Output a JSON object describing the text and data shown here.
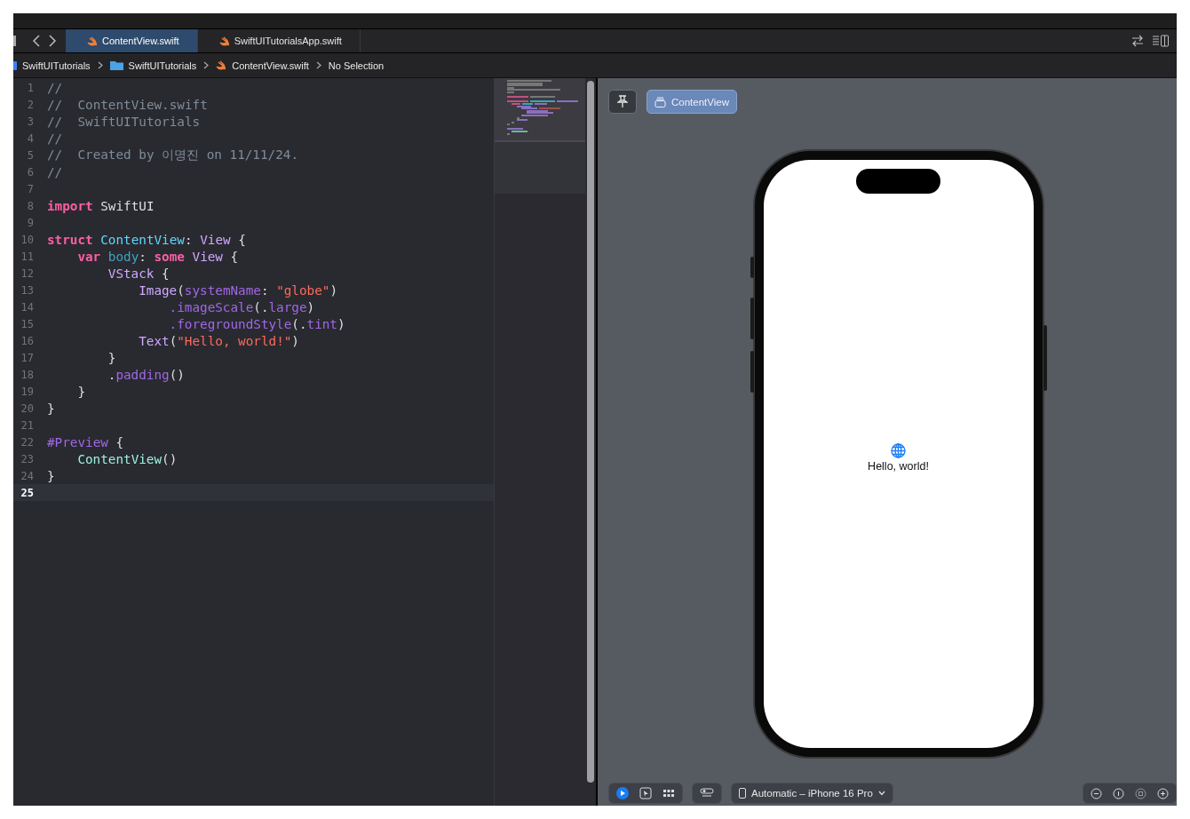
{
  "tab_bar": {
    "tabs": [
      {
        "label": "ContentView.swift",
        "selected": true
      },
      {
        "label": "SwiftUITutorialsApp.swift",
        "selected": false
      }
    ]
  },
  "breadcrumb": [
    {
      "label": "SwiftUITutorials",
      "kind": "project"
    },
    {
      "label": "SwiftUITutorials",
      "kind": "folder"
    },
    {
      "label": "ContentView.swift",
      "kind": "file"
    },
    {
      "label": "No Selection",
      "kind": "text"
    }
  ],
  "editor": {
    "lines": [
      {
        "number": "1",
        "current": false,
        "tokens": [
          {
            "text": "//",
            "kind": "comment"
          }
        ]
      },
      {
        "number": "2",
        "current": false,
        "tokens": [
          {
            "text": "//  ContentView.swift",
            "kind": "comment"
          }
        ]
      },
      {
        "number": "3",
        "current": false,
        "tokens": [
          {
            "text": "//  SwiftUITutorials",
            "kind": "comment"
          }
        ]
      },
      {
        "number": "4",
        "current": false,
        "tokens": [
          {
            "text": "//",
            "kind": "comment"
          }
        ]
      },
      {
        "number": "5",
        "current": false,
        "tokens": [
          {
            "text": "//  Created by 이명진 on 11/11/24.",
            "kind": "comment"
          }
        ]
      },
      {
        "number": "6",
        "current": false,
        "tokens": [
          {
            "text": "//",
            "kind": "comment"
          }
        ]
      },
      {
        "number": "7",
        "current": false
      },
      {
        "number": "8",
        "current": false,
        "tokens": [
          {
            "text": "import",
            "kind": "keyword"
          },
          {
            "text": " SwiftUI",
            "kind": "plain"
          }
        ]
      },
      {
        "number": "9",
        "current": false
      },
      {
        "number": "10",
        "current": false,
        "tokens": [
          {
            "text": "struct",
            "kind": "keyword"
          },
          {
            "text": " ContentView",
            "kind": "decl"
          },
          {
            "text": ": ",
            "kind": "plain"
          },
          {
            "text": "View",
            "kind": "type"
          },
          {
            "text": " {",
            "kind": "plain"
          }
        ],
        "children": [
          {
            "number": "11",
            "current": false,
            "tokens": [
              {
                "text": "var",
                "kind": "keyword"
              },
              {
                "text": " body",
                "kind": "property"
              },
              {
                "text": ": ",
                "kind": "plain"
              },
              {
                "text": "some",
                "kind": "keyword"
              },
              {
                "text": " View",
                "kind": "type"
              },
              {
                "text": " {",
                "kind": "plain"
              }
            ],
            "children": [
              {
                "number": "12",
                "current": false,
                "tokens": [
                  {
                    "text": "VStack",
                    "kind": "type"
                  },
                  {
                    "text": " {",
                    "kind": "plain"
                  }
                ],
                "children": [
                  {
                    "number": "13",
                    "current": false,
                    "tokens": [
                      {
                        "text": "Image",
                        "kind": "type"
                      },
                      {
                        "text": "(",
                        "kind": "plain"
                      },
                      {
                        "text": "systemName",
                        "kind": "member"
                      },
                      {
                        "text": ": ",
                        "kind": "plain"
                      },
                      {
                        "text": "\"globe\"",
                        "kind": "string"
                      },
                      {
                        "text": ")",
                        "kind": "plain"
                      }
                    ],
                    "children": [
                      {
                        "number": "14",
                        "current": false,
                        "tokens": [
                          {
                            "text": ".imageScale",
                            "kind": "member"
                          },
                          {
                            "text": "(.",
                            "kind": "plain"
                          },
                          {
                            "text": "large",
                            "kind": "member"
                          },
                          {
                            "text": ")",
                            "kind": "plain"
                          }
                        ]
                      },
                      {
                        "number": "15",
                        "current": false,
                        "tokens": [
                          {
                            "text": ".foregroundStyle",
                            "kind": "member"
                          },
                          {
                            "text": "(.",
                            "kind": "plain"
                          },
                          {
                            "text": "tint",
                            "kind": "member"
                          },
                          {
                            "text": ")",
                            "kind": "plain"
                          }
                        ]
                      }
                    ]
                  },
                  {
                    "number": "16",
                    "current": false,
                    "tokens": [
                      {
                        "text": "Text",
                        "kind": "type"
                      },
                      {
                        "text": "(",
                        "kind": "plain"
                      },
                      {
                        "text": "\"Hello, world!\"",
                        "kind": "string"
                      },
                      {
                        "text": ")",
                        "kind": "plain"
                      }
                    ]
                  }
                ]
              },
              {
                "number": "17",
                "current": false,
                "tokens": [
                  {
                    "text": "}",
                    "kind": "plain"
                  }
                ]
              },
              {
                "number": "18",
                "current": false,
                "tokens": [
                  {
                    "text": ".",
                    "kind": "plain"
                  },
                  {
                    "text": "padding",
                    "kind": "member"
                  },
                  {
                    "text": "()",
                    "kind": "plain"
                  }
                ]
              }
            ]
          },
          {
            "number": "19",
            "current": false,
            "tokens": [
              {
                "text": "}",
                "kind": "plain"
              }
            ]
          }
        ]
      },
      {
        "number": "20",
        "current": false,
        "tokens": [
          {
            "text": "}",
            "kind": "plain"
          }
        ]
      },
      {
        "number": "21",
        "current": false
      },
      {
        "number": "22",
        "current": false,
        "tokens": [
          {
            "text": "#Preview",
            "kind": "macro"
          },
          {
            "text": " {",
            "kind": "plain"
          }
        ],
        "children": [
          {
            "number": "23",
            "current": false,
            "tokens": [
              {
                "text": "ContentView",
                "kind": "call"
              },
              {
                "text": "()",
                "kind": "plain"
              }
            ]
          }
        ]
      },
      {
        "number": "24",
        "current": false,
        "tokens": [
          {
            "text": "}",
            "kind": "plain"
          }
        ]
      },
      {
        "number": "25",
        "current": true
      }
    ]
  },
  "preview": {
    "previews": [
      {
        "label": "ContentView",
        "selected": true
      }
    ],
    "screen_text": "Hello, world!",
    "device": "Automatic – iPhone 16 Pro"
  }
}
